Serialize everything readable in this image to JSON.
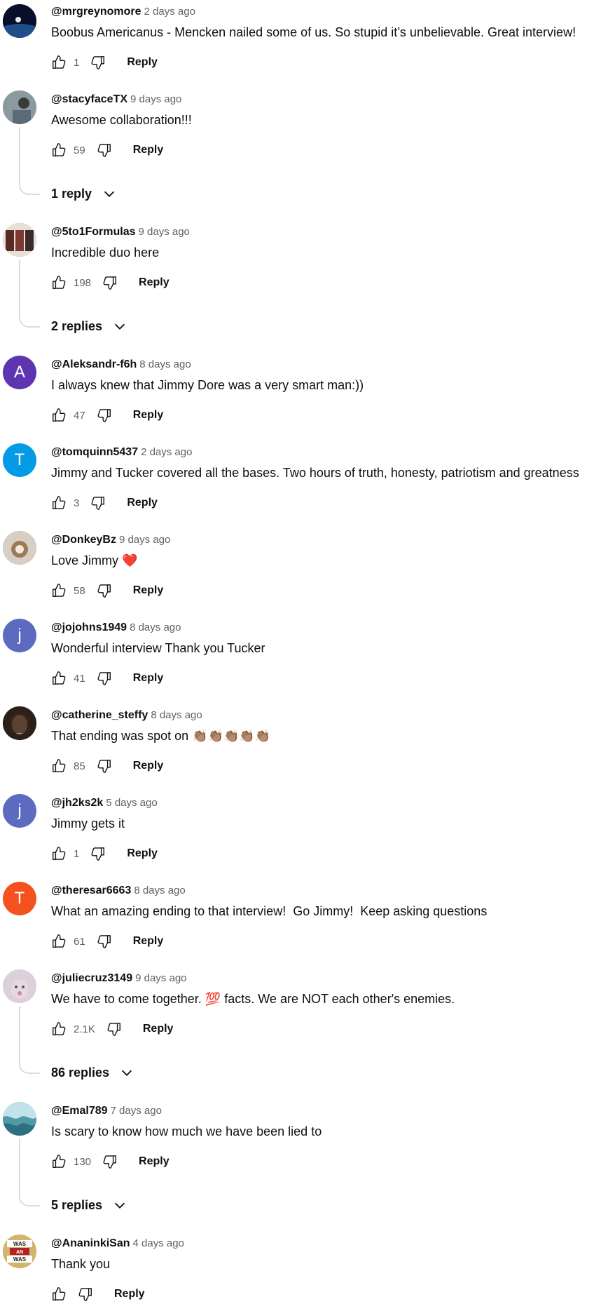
{
  "icons": {
    "like": "thumbs-up-icon",
    "dislike": "thumbs-down-icon",
    "expand": "chevron-down-icon"
  },
  "comments": [
    {
      "author": "@mrgreynomore",
      "time": "2 days ago",
      "text": "Boobus Americanus - Mencken nailed some of us. So stupid it’s unbelievable. Great interview!",
      "likes": "1",
      "reply": "Reply",
      "avatar": "earth-photo",
      "avatar_color": "#0a1a3a"
    },
    {
      "author": "@stacyfaceTX",
      "time": "9 days ago",
      "text": "Awesome collaboration!!!",
      "likes": "59",
      "reply": "Reply",
      "avatar": "photo",
      "avatar_color": "#6b7d88",
      "replies": "1 reply"
    },
    {
      "author": "@5to1Formulas",
      "time": "9 days ago",
      "text": "Incredible duo here",
      "likes": "198",
      "reply": "Reply",
      "avatar": "photo",
      "avatar_color": "#7a4b3b",
      "replies": "2 replies"
    },
    {
      "author": "@Aleksandr-f6h",
      "time": "8 days ago",
      "text": "I always knew that Jimmy Dore was a very smart man:))",
      "likes": "47",
      "reply": "Reply",
      "avatar_letter": "A",
      "avatar_color": "#5e35b1"
    },
    {
      "author": "@tomquinn5437",
      "time": "2 days ago",
      "text": "Jimmy and Tucker covered all the bases. Two hours of truth, honesty, patriotism and greatness",
      "likes": "3",
      "reply": "Reply",
      "avatar_letter": "T",
      "avatar_color": "#039be5"
    },
    {
      "author": "@DonkeyBz",
      "time": "9 days ago",
      "text": "Love Jimmy",
      "emoji": "❤️",
      "likes": "58",
      "reply": "Reply",
      "avatar": "photo",
      "avatar_color": "#8d7a66"
    },
    {
      "author": "@jojohns1949",
      "time": "8 days ago",
      "text": "Wonderful interview Thank you Tucker",
      "likes": "41",
      "reply": "Reply",
      "avatar_letter": "j",
      "avatar_color": "#5c6bc0"
    },
    {
      "author": "@catherine_steffy",
      "time": "8 days ago",
      "text": "That ending was spot on",
      "emoji": "👏🏽👏🏽👏🏽👏🏽👏🏽",
      "likes": "85",
      "reply": "Reply",
      "avatar": "photo",
      "avatar_color": "#3e2c25"
    },
    {
      "author": "@jh2ks2k",
      "time": "5 days ago",
      "text": "Jimmy gets it",
      "likes": "1",
      "reply": "Reply",
      "avatar_letter": "j",
      "avatar_color": "#5c6bc0"
    },
    {
      "author": "@theresar6663",
      "time": "8 days ago",
      "text": "What an amazing ending to that interview!  Go Jimmy!  Keep asking questions",
      "likes": "61",
      "reply": "Reply",
      "avatar_letter": "T",
      "avatar_color": "#f4511e"
    },
    {
      "author": "@juliecruz3149",
      "time": "9 days ago",
      "text": "We have to come together.",
      "emoji": "💯",
      "text2": "facts. We are NOT each other's enemies.",
      "likes": "2.1K",
      "reply": "Reply",
      "avatar": "photo",
      "avatar_color": "#c9b6c9",
      "replies": "86 replies"
    },
    {
      "author": "@Emal789",
      "time": "7 days ago",
      "text": "Is scary to know how much we have been lied to",
      "likes": "130",
      "reply": "Reply",
      "avatar": "photo",
      "avatar_color": "#4f9aa7",
      "replies": "5 replies"
    },
    {
      "author": "@AnaninkiSan",
      "time": "4 days ago",
      "text": "Thank you",
      "likes": "",
      "reply": "Reply",
      "avatar": "logo",
      "avatar_color": "#c4a55a",
      "avatar_logo_text": "WAS AN WAS"
    }
  ]
}
